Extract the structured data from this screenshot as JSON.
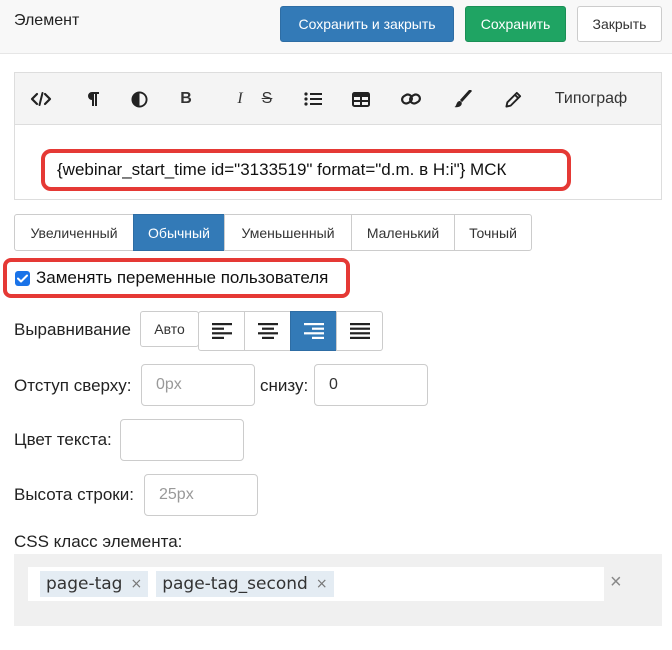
{
  "header": {
    "title": "Элемент",
    "save_close_label": "Сохранить и закрыть",
    "save_label": "Сохранить",
    "close_label": "Закрыть"
  },
  "toolbar": {
    "tools": [
      "code-icon",
      "pilcrow-icon",
      "contrast-icon",
      "bold-icon",
      "italic-icon",
      "strikethrough-icon",
      "list-icon",
      "table-icon",
      "link-icon",
      "brush-icon",
      "pencil-icon"
    ],
    "bold_glyph": "B",
    "italic_glyph": "I",
    "strike_glyph": "S",
    "typograf_label": "Типограф"
  },
  "editor": {
    "content": "{webinar_start_time id=\"3133519\" format=\"d.m. в H:i\"} МСК"
  },
  "sizes": {
    "items": [
      "Увеличенный",
      "Обычный",
      "Уменьшенный",
      "Маленький",
      "Точный"
    ],
    "active": "Обычный"
  },
  "replace_vars": {
    "label": "Заменять переменные пользователя",
    "checked": true
  },
  "alignment": {
    "label": "Выравнивание",
    "auto_label": "Авто",
    "options": [
      "align-left-icon",
      "align-center-icon",
      "align-right-icon",
      "align-justify-icon"
    ],
    "active": "align-right-icon"
  },
  "padding": {
    "top_label": "Отступ сверху:",
    "top_placeholder": "0px",
    "bottom_label": "снизу:",
    "bottom_value": "0"
  },
  "text_color": {
    "label": "Цвет текста:",
    "value": ""
  },
  "line_height": {
    "label": "Высота строки:",
    "placeholder": "25px"
  },
  "css_class": {
    "label": "CSS класс элемента:",
    "tags": [
      "page-tag",
      "page-tag_second"
    ],
    "tag_remove_glyph": "×",
    "clear_glyph": "×"
  },
  "colors": {
    "primary": "#337ab7",
    "success": "#1fa463",
    "highlight": "#e53935",
    "checkbox": "#1a73e8"
  }
}
